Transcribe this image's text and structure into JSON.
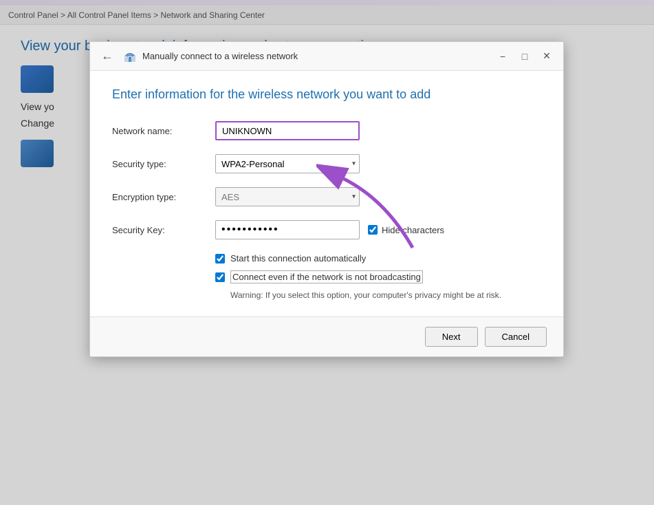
{
  "background": {
    "breadcrumb": "Control Panel > All Control Panel Items > Network and Sharing Center",
    "title": "View your basic network information and set up connections",
    "subtitle": "View yo",
    "change_label": "Change"
  },
  "dialog": {
    "title": "Manually connect to a wireless network",
    "heading": "Enter information for the wireless network you want to add",
    "back_arrow": "←",
    "minimize_label": "−",
    "maximize_label": "□",
    "close_label": "✕",
    "fields": {
      "network_name_label": "Network name:",
      "network_name_value": "UNIKNOWN",
      "security_type_label": "Security type:",
      "security_type_value": "WPA2-Personal",
      "encryption_type_label": "Encryption type:",
      "encryption_type_value": "AES",
      "security_key_label": "Security Key:",
      "security_key_value": "••••••••••",
      "hide_characters_label": "Hide characters"
    },
    "checkboxes": {
      "auto_connect_label": "Start this connection automatically",
      "auto_connect_checked": true,
      "broadcast_label": "Connect even if the network is not broadcasting",
      "broadcast_checked": true,
      "warning": "Warning: If you select this option, your computer's privacy might be at risk."
    },
    "footer": {
      "next_label": "Next",
      "cancel_label": "Cancel"
    }
  },
  "colors": {
    "accent_purple": "#9b4fc8",
    "accent_blue": "#1e6fb0",
    "checkbox_blue": "#0078d4"
  }
}
